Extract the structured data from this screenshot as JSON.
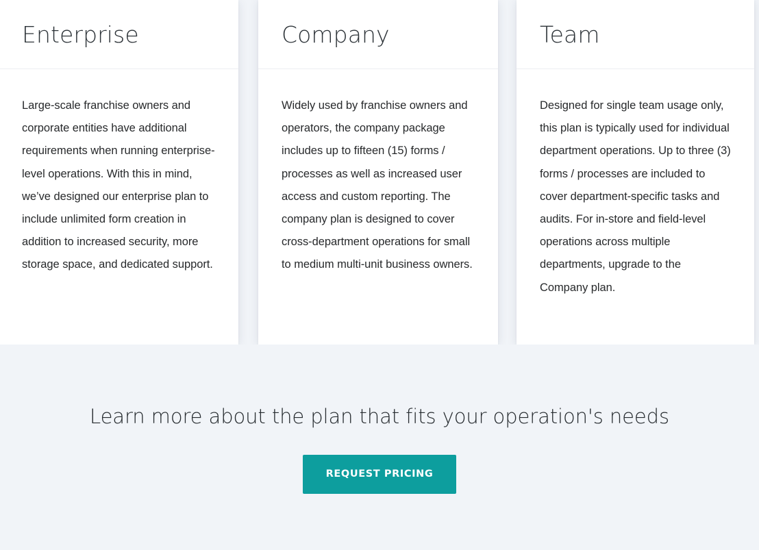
{
  "theme": {
    "page_background": "#f1f4f8",
    "card_background": "#ffffff",
    "accent": "#0d9e9e",
    "heading_color": "#2d3338",
    "body_text_color": "#27292b",
    "divider_color": "#eceef1"
  },
  "plans": [
    {
      "title": "Enterprise",
      "description": "Large-scale franchise owners and corporate entities have additional requirements when running enterprise-level operations. With this in mind, we’ve designed our enterprise plan to include unlimited form creation in addition to increased security, more storage space, and dedicated support."
    },
    {
      "title": "Company",
      "description": "Widely used by franchise owners and operators, the company package includes up to fifteen (15) forms / processes as well as increased user access and custom reporting. The company plan is designed to cover cross-department operations for small to medium multi-unit business owners."
    },
    {
      "title": "Team",
      "description": "Designed for single team usage only, this plan is typically used for individual department operations. Up to three (3) forms / processes are included to cover department-specific tasks and audits. For in-store and field-level operations across multiple departments, upgrade to the Company plan."
    }
  ],
  "cta": {
    "heading": "Learn more about the plan that fits your operation's needs",
    "button_label": "REQUEST PRICING"
  }
}
